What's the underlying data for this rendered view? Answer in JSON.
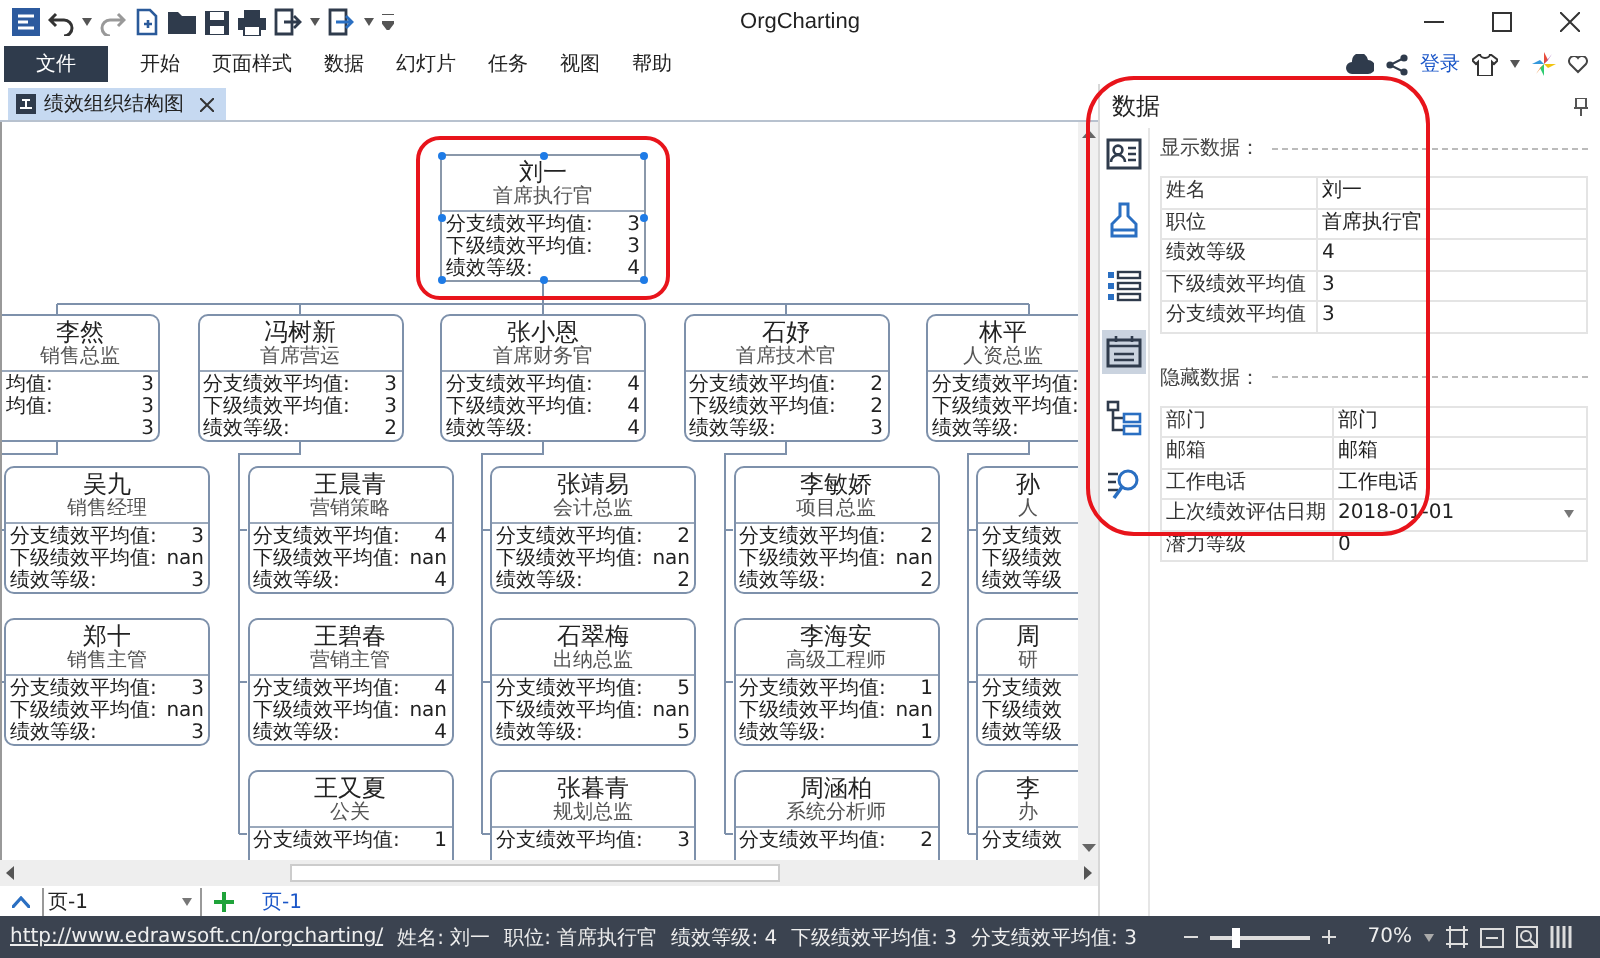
{
  "app": {
    "title": "OrgCharting"
  },
  "menu": {
    "file": "文件",
    "items": [
      "开始",
      "页面样式",
      "数据",
      "幻灯片",
      "任务",
      "视图",
      "帮助"
    ],
    "login": "登录"
  },
  "document_tab": {
    "label": "绩效组织结构图",
    "selected": true
  },
  "chart": {
    "root": {
      "name": "刘一",
      "title": "首席执行官",
      "selected": true,
      "highlighted": true,
      "rows": [
        {
          "label": "分支绩效平均值:",
          "value": "3"
        },
        {
          "label": "下级绩效平均值:",
          "value": "3"
        },
        {
          "label": "绩效等级:",
          "value": "4"
        }
      ],
      "children": [
        {
          "name": "李然",
          "title": "销售总监",
          "selected": false,
          "rows": [
            {
              "label": "均值:",
              "value": "3"
            },
            {
              "label": "均值:",
              "value": "3"
            },
            {
              "value": "3"
            }
          ],
          "children": [
            {
              "name": "吴九",
              "title": "销售经理",
              "selected": false,
              "rows": [
                {
                  "label": "分支绩效平均值:",
                  "value": "3"
                },
                {
                  "label": "下级绩效平均值:",
                  "value": "nan"
                },
                {
                  "label": "绩效等级:",
                  "value": "3"
                }
              ]
            },
            {
              "name": "郑十",
              "title": "销售主管",
              "selected": false,
              "rows": [
                {
                  "label": "分支绩效平均值:",
                  "value": "3"
                },
                {
                  "label": "下级绩效平均值:",
                  "value": "nan"
                },
                {
                  "label": "绩效等级:",
                  "value": "3"
                }
              ]
            }
          ]
        },
        {
          "name": "冯树新",
          "title": "首席营运",
          "selected": false,
          "rows": [
            {
              "label": "分支绩效平均值:",
              "value": "3"
            },
            {
              "label": "下级绩效平均值:",
              "value": "3"
            },
            {
              "label": "绩效等级:",
              "value": "2"
            }
          ],
          "children": [
            {
              "name": "王晨青",
              "title": "营销策略",
              "selected": false,
              "rows": [
                {
                  "label": "分支绩效平均值:",
                  "value": "4"
                },
                {
                  "label": "下级绩效平均值:",
                  "value": "nan"
                },
                {
                  "label": "绩效等级:",
                  "value": "4"
                }
              ]
            },
            {
              "name": "王碧春",
              "title": "营销主管",
              "selected": false,
              "rows": [
                {
                  "label": "分支绩效平均值:",
                  "value": "4"
                },
                {
                  "label": "下级绩效平均值:",
                  "value": "nan"
                },
                {
                  "label": "绩效等级:",
                  "value": "4"
                }
              ]
            },
            {
              "name": "王又夏",
              "title": "公关",
              "selected": false,
              "rows": [
                {
                  "label": "分支绩效平均值:",
                  "value": "1"
                }
              ]
            }
          ]
        },
        {
          "name": "张小恩",
          "title": "首席财务官",
          "selected": false,
          "rows": [
            {
              "label": "分支绩效平均值:",
              "value": "4"
            },
            {
              "label": "下级绩效平均值:",
              "value": "4"
            },
            {
              "label": "绩效等级:",
              "value": "4"
            }
          ],
          "children": [
            {
              "name": "张靖易",
              "title": "会计总监",
              "selected": false,
              "rows": [
                {
                  "label": "分支绩效平均值:",
                  "value": "2"
                },
                {
                  "label": "下级绩效平均值:",
                  "value": "nan"
                },
                {
                  "label": "绩效等级:",
                  "value": "2"
                }
              ]
            },
            {
              "name": "石翠梅",
              "title": "出纳总监",
              "selected": false,
              "rows": [
                {
                  "label": "分支绩效平均值:",
                  "value": "5"
                },
                {
                  "label": "下级绩效平均值:",
                  "value": "nan"
                },
                {
                  "label": "绩效等级:",
                  "value": "5"
                }
              ]
            },
            {
              "name": "张暮青",
              "title": "规划总监",
              "selected": false,
              "rows": [
                {
                  "label": "分支绩效平均值:",
                  "value": "3"
                }
              ]
            }
          ]
        },
        {
          "name": "石妤",
          "title": "首席技术官",
          "selected": false,
          "rows": [
            {
              "label": "分支绩效平均值:",
              "value": "2"
            },
            {
              "label": "下级绩效平均值:",
              "value": "2"
            },
            {
              "label": "绩效等级:",
              "value": "3"
            }
          ],
          "children": [
            {
              "name": "李敏娇",
              "title": "项目总监",
              "selected": false,
              "rows": [
                {
                  "label": "分支绩效平均值:",
                  "value": "2"
                },
                {
                  "label": "下级绩效平均值:",
                  "value": "nan"
                },
                {
                  "label": "绩效等级:",
                  "value": "2"
                }
              ]
            },
            {
              "name": "李海安",
              "title": "高级工程师",
              "selected": false,
              "rows": [
                {
                  "label": "分支绩效平均值:",
                  "value": "1"
                },
                {
                  "label": "下级绩效平均值:",
                  "value": "nan"
                },
                {
                  "label": "绩效等级:",
                  "value": "1"
                }
              ]
            },
            {
              "name": "周涵柏",
              "title": "系统分析师",
              "selected": false,
              "rows": [
                {
                  "label": "分支绩效平均值:",
                  "value": "2"
                }
              ]
            }
          ]
        },
        {
          "name": "林平",
          "title": "人资总监",
          "selected": false,
          "rows": [
            {
              "label": "分支绩效平均值:"
            },
            {
              "label": "下级绩效平均值:"
            },
            {
              "label": "绩效等级:"
            }
          ],
          "children": [
            {
              "name": "孙",
              "title": "人",
              "selected": false,
              "rows": [
                {
                  "label": "分支绩效"
                },
                {
                  "label": "下级绩效"
                },
                {
                  "label": "绩效等级"
                }
              ]
            },
            {
              "name": "周",
              "title": "研",
              "selected": false,
              "rows": [
                {
                  "label": "分支绩效"
                },
                {
                  "label": "下级绩效"
                },
                {
                  "label": "绩效等级"
                }
              ]
            },
            {
              "name": "李",
              "title": "办",
              "selected": false,
              "rows": [
                {
                  "label": "分支绩效"
                }
              ]
            }
          ]
        }
      ]
    }
  },
  "panel": {
    "title": "数据",
    "highlighted": true,
    "tools": [
      {
        "selected": false
      },
      {
        "selected": false
      },
      {
        "selected": false
      },
      {
        "selected": true
      },
      {
        "selected": false
      },
      {
        "selected": false
      }
    ],
    "sections": [
      {
        "heading": "显示数据：",
        "rows": [
          {
            "label": "姓名",
            "value": "刘一",
            "kind": "text"
          },
          {
            "label": "职位",
            "value": "首席执行官",
            "kind": "text"
          },
          {
            "label": "绩效等级",
            "value": "4",
            "kind": "text"
          },
          {
            "label": "下级绩效平均值",
            "value": "3",
            "kind": "text"
          },
          {
            "label": "分支绩效平均值",
            "value": "3",
            "kind": "text"
          }
        ]
      },
      {
        "heading": "隐藏数据：",
        "rows": [
          {
            "label": "部门",
            "value": "部门",
            "kind": "text"
          },
          {
            "label": "邮箱",
            "value": "邮箱",
            "kind": "text"
          },
          {
            "label": "工作电话",
            "value": "工作电话",
            "kind": "text"
          },
          {
            "label": "上次绩效评估日期",
            "value": "2018-01-01",
            "kind": "dropdown"
          },
          {
            "label": "潜力等级",
            "value": "0",
            "kind": "text"
          }
        ]
      }
    ]
  },
  "pages": {
    "current": "页-1",
    "tabs": [
      {
        "label": "页-1",
        "selected": true
      }
    ]
  },
  "status_bar": {
    "link": "http://www.edrawsoft.cn/orgcharting/",
    "fields": [
      "姓名: 刘一",
      "职位: 首席执行官",
      "绩效等级: 4",
      "下级绩效平均值: 3",
      "分支绩效平均值: 3"
    ],
    "zoom": {
      "level": 0.26,
      "label": "70%"
    }
  }
}
